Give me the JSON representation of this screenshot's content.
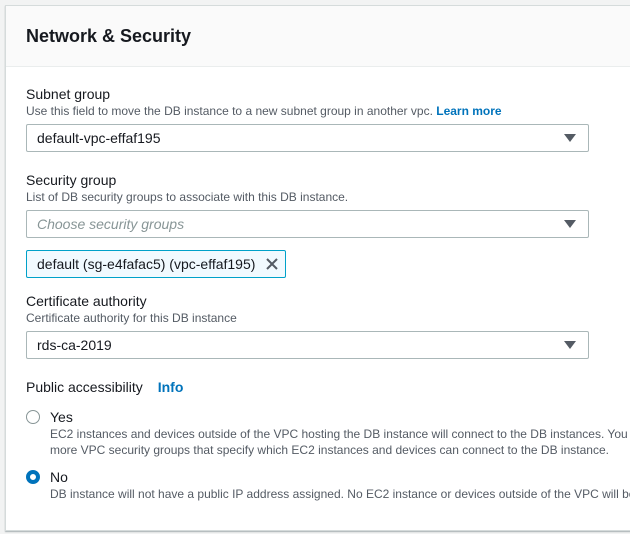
{
  "section": {
    "title": "Network & Security"
  },
  "subnet_group": {
    "label": "Subnet group",
    "description": "Use this field to move the DB instance to a new subnet group in another vpc.",
    "learn_more": "Learn more",
    "value": "default-vpc-effaf195"
  },
  "security_group": {
    "label": "Security group",
    "description": "List of DB security groups to associate with this DB instance.",
    "placeholder": "Choose security groups",
    "tokens": [
      "default (sg-e4fafac5) (vpc-effaf195)"
    ]
  },
  "certificate_authority": {
    "label": "Certificate authority",
    "description": "Certificate authority for this DB instance",
    "value": "rds-ca-2019"
  },
  "public_accessibility": {
    "label": "Public accessibility",
    "info": "Info",
    "options": [
      {
        "label": "Yes",
        "desc_line1": "EC2 instances and devices outside of the VPC hosting the DB instance will connect to the DB instances. You",
        "desc_line2": "more VPC security groups that specify which EC2 instances and devices can connect to the DB instance.",
        "selected": false
      },
      {
        "label": "No",
        "desc_line1": "DB instance will not have a public IP address assigned. No EC2 instance or devices outside of the VPC will be",
        "selected": true
      }
    ]
  },
  "colors": {
    "link": "#0073bb",
    "token_border": "#00a1c9",
    "token_bg": "#f1faff",
    "radio_selected": "#0073bb"
  },
  "icons": {
    "select_caret": "caret-down-icon",
    "token_remove": "close-icon"
  }
}
